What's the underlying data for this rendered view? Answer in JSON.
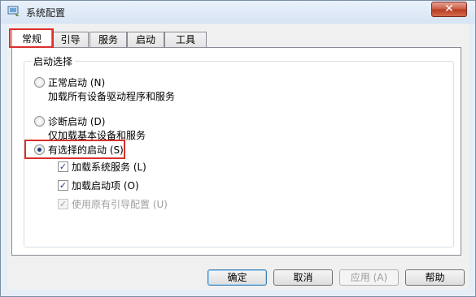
{
  "window": {
    "title": "系统配置",
    "close_glyph": "✕",
    "accent_color": "#d9302c"
  },
  "tabs": [
    {
      "label": "常规",
      "active": true
    },
    {
      "label": "引导",
      "active": false
    },
    {
      "label": "服务",
      "active": false
    },
    {
      "label": "启动",
      "active": false
    },
    {
      "label": "工具",
      "active": false
    }
  ],
  "startup_selection": {
    "group_title": "启动选择",
    "options": [
      {
        "label": "正常启动 (N)",
        "description": "加载所有设备驱动程序和服务",
        "selected": false
      },
      {
        "label": "诊断启动 (D)",
        "description": "仅加载基本设备和服务",
        "selected": false
      },
      {
        "label": "有选择的启动 (S)",
        "selected": true
      }
    ],
    "checkboxes": [
      {
        "label": "加载系统服务 (L)",
        "checked": true,
        "enabled": true
      },
      {
        "label": "加载启动项 (O)",
        "checked": true,
        "enabled": true
      },
      {
        "label": "使用原有引导配置 (U)",
        "checked": true,
        "enabled": false
      }
    ]
  },
  "buttons": {
    "ok": "确定",
    "cancel": "取消",
    "apply": "应用 (A)",
    "help": "帮助"
  }
}
